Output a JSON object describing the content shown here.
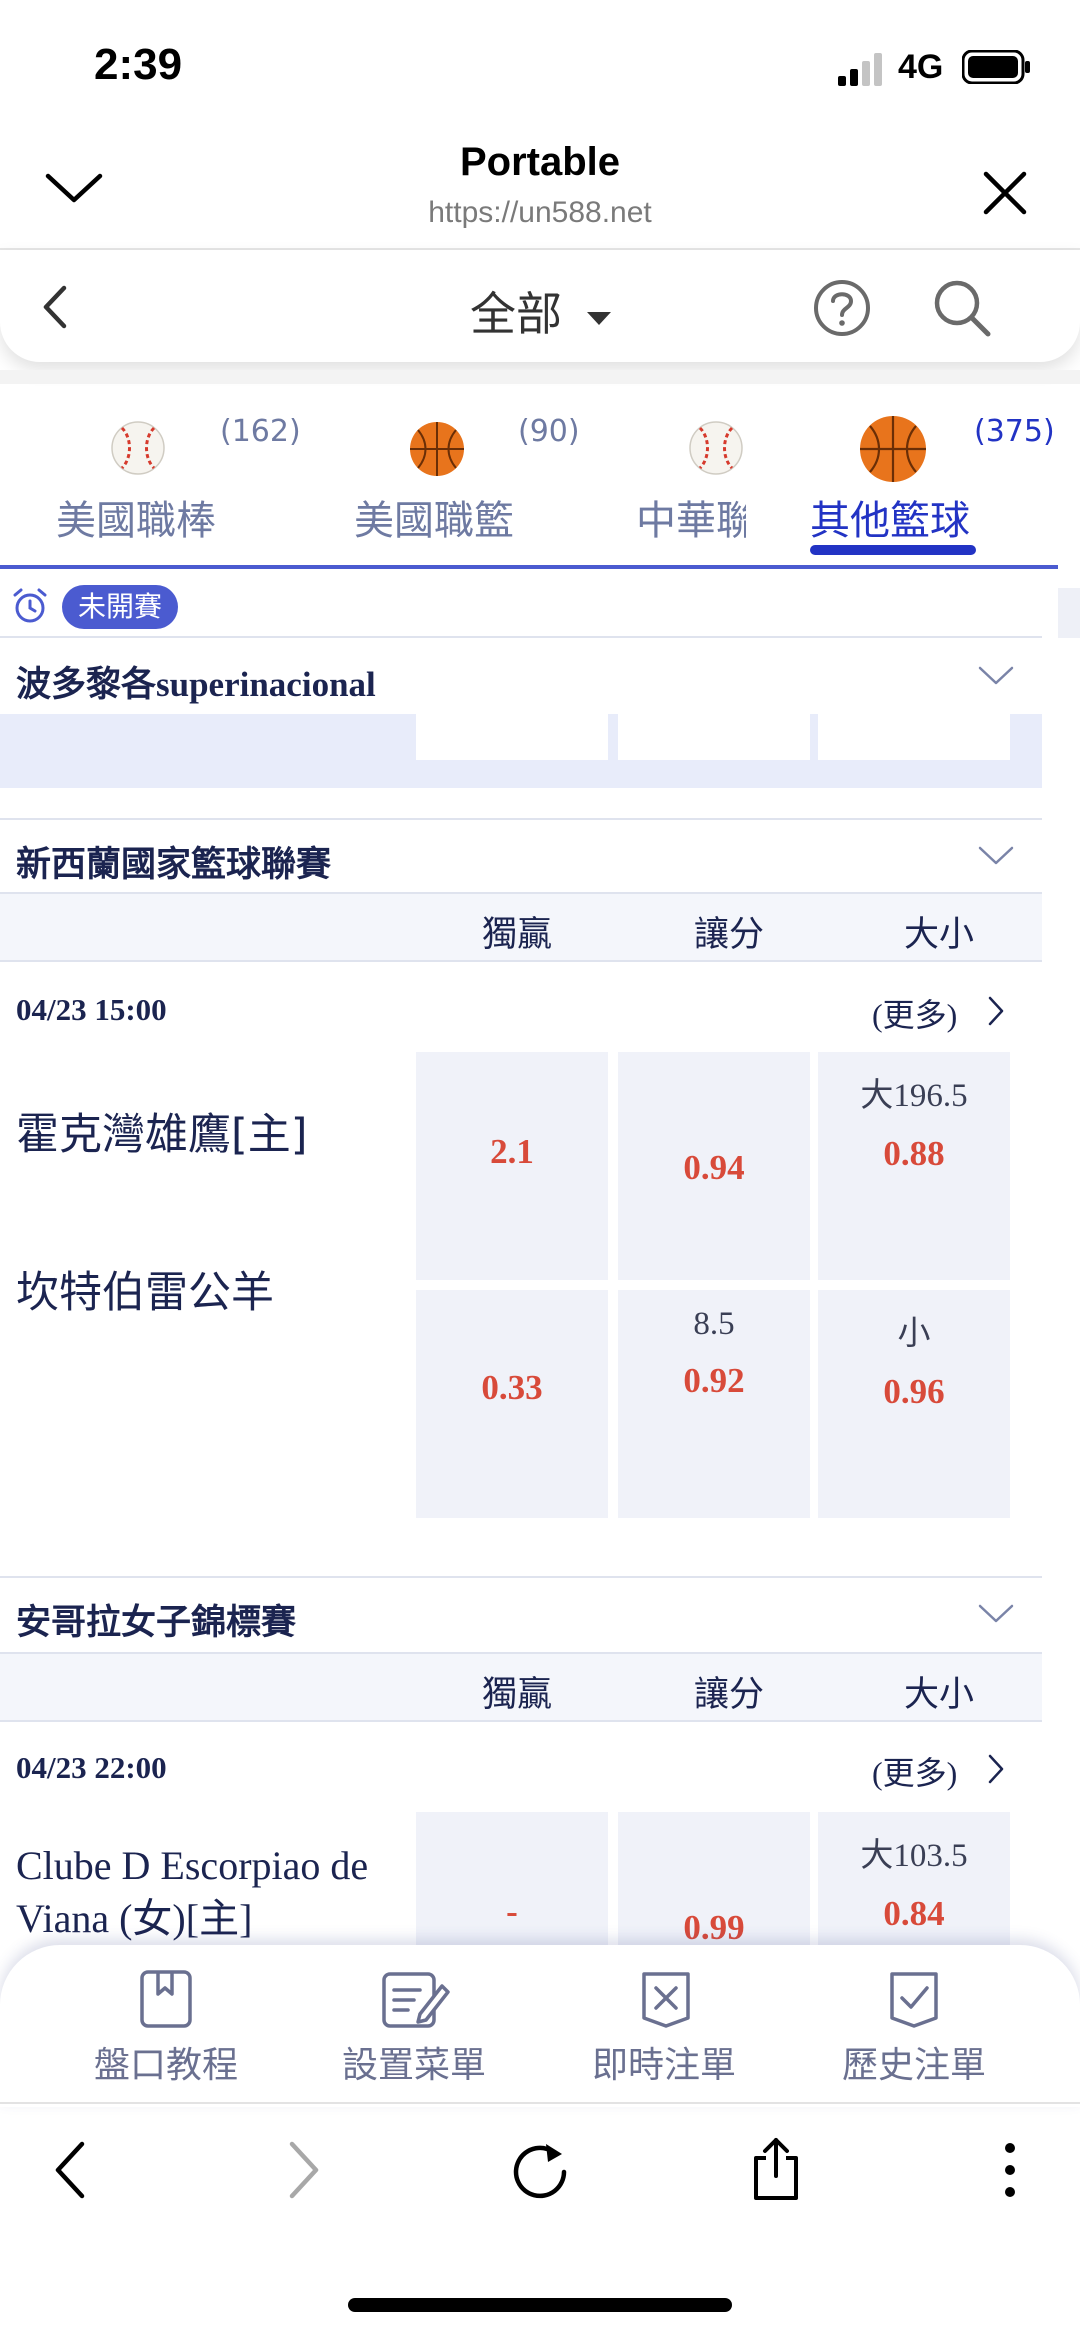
{
  "status_bar": {
    "time": "2:39",
    "network": "4G"
  },
  "browser": {
    "title": "Portable",
    "url": "https://un588.net"
  },
  "app_header": {
    "filter": "全部"
  },
  "sport_tabs": [
    {
      "label": "美國職棒",
      "count": "(162)",
      "icon": "baseball-icon"
    },
    {
      "label": "美國職籃",
      "count": "(90)",
      "icon": "basketball-icon"
    },
    {
      "label": "中華聯",
      "count": "",
      "icon": "baseball-icon"
    },
    {
      "label": "其他籃球",
      "count": "(375)",
      "icon": "basketball-icon",
      "active": true
    }
  ],
  "status_badge": "未開賽",
  "columns": {
    "moneyline": "獨贏",
    "handicap": "讓分",
    "total": "大小"
  },
  "leagues": [
    {
      "name": "波多黎各superinacional"
    },
    {
      "name": "新西蘭國家籃球聯賽",
      "match": {
        "datetime": "04/23  15:00",
        "more": "(更多)",
        "home": "霍克灣雄鷹[主]",
        "away": "坎特伯雷公羊",
        "home_moneyline": "2.1",
        "away_moneyline": "0.33",
        "home_handicap_odds": "0.94",
        "away_handicap_line": "8.5",
        "away_handicap_odds": "0.92",
        "over_line": "大196.5",
        "over_odds": "0.88",
        "under_line": "小",
        "under_odds": "0.96"
      }
    },
    {
      "name": "安哥拉女子錦標賽",
      "match": {
        "datetime": "04/23  22:00",
        "more": "(更多)",
        "home_line1": "Clube D Escorpiao de",
        "home_line2": "Viana (女)[主]",
        "home_moneyline": "-",
        "home_handicap_odds": "0.99",
        "over_line": "大103.5",
        "over_odds": "0.84"
      }
    }
  ],
  "toolbar": [
    {
      "label": "盤口教程",
      "icon": "book-icon"
    },
    {
      "label": "設置菜單",
      "icon": "edit-list-icon"
    },
    {
      "label": "即時注單",
      "icon": "cancel-slip-icon"
    },
    {
      "label": "歷史注單",
      "icon": "check-slip-icon"
    }
  ],
  "colors": {
    "accent": "#2233c4",
    "odds": "#d84a3a",
    "text": "#1b2450",
    "cell": "#f0f2f9"
  }
}
